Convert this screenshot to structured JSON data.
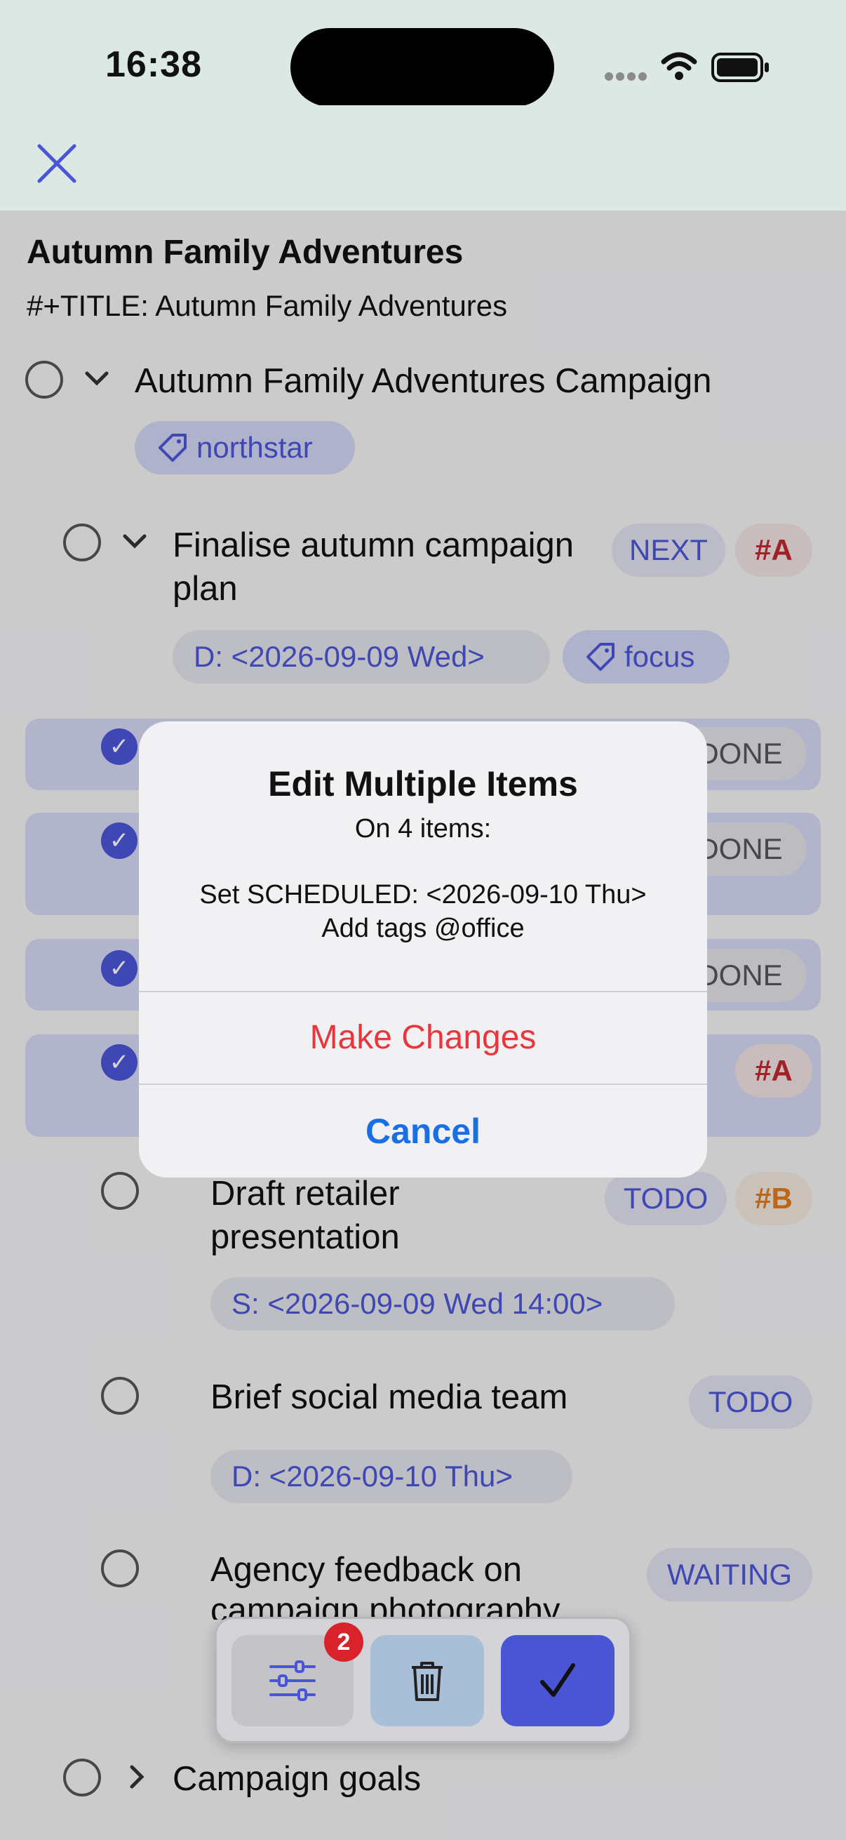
{
  "status_bar": {
    "time": "16:38"
  },
  "nav": {
    "close_icon": "close-x-icon"
  },
  "document": {
    "title": "Autumn Family Adventures",
    "meta": "#+TITLE: Autumn Family Adventures"
  },
  "items": {
    "campaign": {
      "label": "Autumn Family Adventures Campaign",
      "tag": "northstar"
    },
    "finalise": {
      "label_line1": "Finalise autumn campaign",
      "label_line2": "plan",
      "keyword": "NEXT",
      "priority": "#A",
      "deadline": "D: <2026-09-09 Wed>",
      "tag": "focus"
    },
    "sel1": {
      "keyword": "DONE"
    },
    "sel2": {
      "keyword": "DONE"
    },
    "sel3": {
      "keyword": "DONE"
    },
    "sel4": {
      "priority": "#A"
    },
    "draft": {
      "label_line1": "Draft retailer",
      "label_line2": "presentation",
      "keyword": "TODO",
      "priority": "#B",
      "scheduled": "S: <2026-09-09 Wed 14:00>"
    },
    "brief": {
      "label": "Brief social media team",
      "keyword": "TODO",
      "deadline": "D: <2026-09-10 Thu>"
    },
    "agency": {
      "label_line1": "Agency feedback on",
      "label_line2": "campaign photography",
      "keyword": "WAITING"
    },
    "goals": {
      "label": "Campaign goals"
    }
  },
  "alert": {
    "title": "Edit Multiple Items",
    "subtitle": "On 4 items:",
    "line1": "Set SCHEDULED: <2026-09-10 Thu>",
    "line2": "Add tags @office",
    "confirm": "Make Changes",
    "cancel": "Cancel"
  },
  "toolbar": {
    "filter_badge": "2",
    "filter_icon": "sliders-icon",
    "delete_icon": "trash-icon",
    "done_icon": "checkmark-icon"
  },
  "colors": {
    "accent": "#4a55d6",
    "destructive": "#e5373d",
    "link": "#1a6fe6",
    "priority_a": "#c0282f",
    "priority_b": "#e07a1c"
  }
}
